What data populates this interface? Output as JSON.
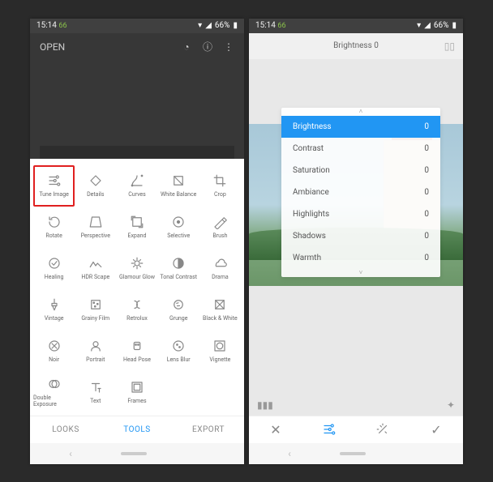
{
  "status": {
    "time": "15:14",
    "ticker": "66",
    "battery_pct": "66%"
  },
  "left": {
    "open_label": "OPEN",
    "tabs": {
      "looks": "LOOKS",
      "tools": "TOOLS",
      "export": "EXPORT"
    },
    "tools": [
      {
        "id": "tune",
        "label": "Tune Image",
        "highlight": true
      },
      {
        "id": "details",
        "label": "Details"
      },
      {
        "id": "curves",
        "label": "Curves"
      },
      {
        "id": "wb",
        "label": "White Balance"
      },
      {
        "id": "crop",
        "label": "Crop"
      },
      {
        "id": "rotate",
        "label": "Rotate"
      },
      {
        "id": "perspective",
        "label": "Perspective"
      },
      {
        "id": "expand",
        "label": "Expand"
      },
      {
        "id": "selective",
        "label": "Selective"
      },
      {
        "id": "brush",
        "label": "Brush"
      },
      {
        "id": "healing",
        "label": "Healing"
      },
      {
        "id": "hdr",
        "label": "HDR Scape"
      },
      {
        "id": "glow",
        "label": "Glamour Glow"
      },
      {
        "id": "tonal",
        "label": "Tonal Contrast"
      },
      {
        "id": "drama",
        "label": "Drama"
      },
      {
        "id": "vintage",
        "label": "Vintage"
      },
      {
        "id": "grain",
        "label": "Grainy Film"
      },
      {
        "id": "retro",
        "label": "Retrolux"
      },
      {
        "id": "grunge",
        "label": "Grunge"
      },
      {
        "id": "bw",
        "label": "Black & White"
      },
      {
        "id": "noir",
        "label": "Noir"
      },
      {
        "id": "portrait",
        "label": "Portrait"
      },
      {
        "id": "headpose",
        "label": "Head Pose"
      },
      {
        "id": "lensblur",
        "label": "Lens Blur"
      },
      {
        "id": "vignette",
        "label": "Vignette"
      },
      {
        "id": "dblexp",
        "label": "Double Exposure"
      },
      {
        "id": "text",
        "label": "Text"
      },
      {
        "id": "frames",
        "label": "Frames"
      }
    ]
  },
  "right": {
    "header_value": "Brightness 0",
    "sliders": [
      {
        "name": "Brightness",
        "value": 0,
        "selected": true
      },
      {
        "name": "Contrast",
        "value": 0
      },
      {
        "name": "Saturation",
        "value": 0
      },
      {
        "name": "Ambiance",
        "value": 0
      },
      {
        "name": "Highlights",
        "value": 0
      },
      {
        "name": "Shadows",
        "value": 0
      },
      {
        "name": "Warmth",
        "value": 0
      }
    ]
  }
}
